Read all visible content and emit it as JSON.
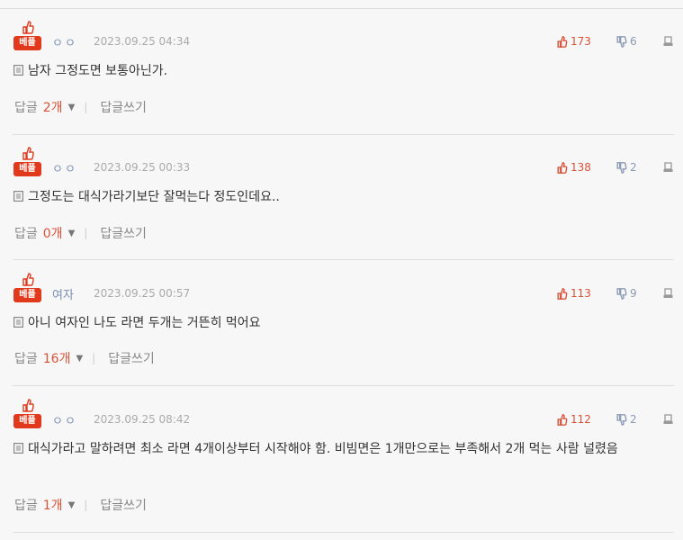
{
  "comments": [
    {
      "badge": "베플",
      "author": "ㅇㅇ",
      "date": "2023.09.25 04:34",
      "up": "173",
      "down": "6",
      "text": "남자 그정도면 보통아닌가.",
      "reply_label": "답글",
      "reply_count": "2개",
      "write_label": "답글쓰기"
    },
    {
      "badge": "베플",
      "author": "ㅇㅇ",
      "date": "2023.09.25 00:33",
      "up": "138",
      "down": "2",
      "text": "그정도는 대식가라기보단 잘먹는다 정도인데요..",
      "reply_label": "답글",
      "reply_count": "0개",
      "write_label": "답글쓰기"
    },
    {
      "badge": "베플",
      "author": "여자",
      "date": "2023.09.25 00:57",
      "up": "113",
      "down": "9",
      "text": "아니 여자인 나도 라면 두개는 거뜬히 먹어요",
      "reply_label": "답글",
      "reply_count": "16개",
      "write_label": "답글쓰기"
    },
    {
      "badge": "베플",
      "author": "ㅇㅇ",
      "date": "2023.09.25 08:42",
      "up": "112",
      "down": "2",
      "text": "대식가라고 말하려면 최소 라면 4개이상부터 시작해야 함. 비빔면은 1개만으로는 부족해서 2개 먹는 사람 널렸음",
      "reply_label": "답글",
      "reply_count": "1개",
      "write_label": "답글쓰기"
    }
  ],
  "icons": {
    "best": "thumbs-up-icon",
    "up": "thumbs-up-icon",
    "down": "thumbs-down-icon",
    "report": "report-icon",
    "text": "document-icon",
    "caret": "caret-down-icon"
  },
  "colors": {
    "badge": "#e1391b",
    "upvote": "#d9533a",
    "downvote": "#8a9ab3"
  }
}
